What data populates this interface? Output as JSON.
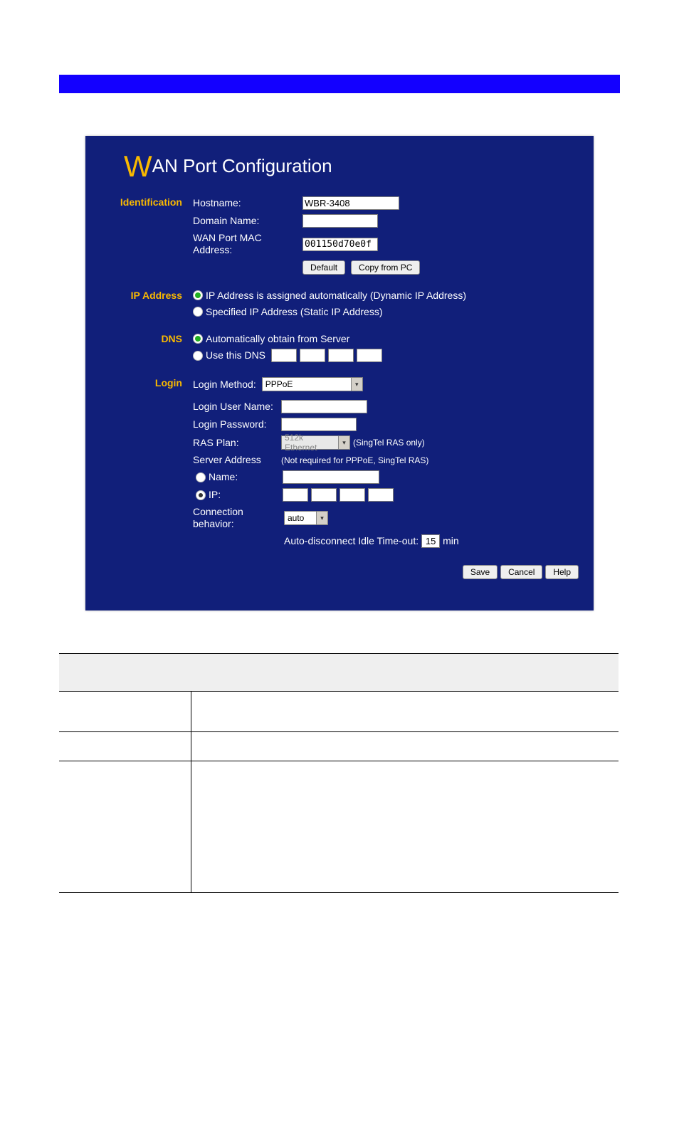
{
  "header": {
    "title_rest": "AN Port Configuration",
    "title_cap": "W"
  },
  "identification": {
    "label": "Identification",
    "hostname_label": "Hostname:",
    "hostname": "WBR-3408",
    "domain_label": "Domain Name:",
    "domain": "",
    "mac_label": "WAN Port MAC Address:",
    "mac": "001150d70e0f",
    "default_btn": "Default",
    "copy_btn": "Copy from PC"
  },
  "ip_address": {
    "label": "IP Address",
    "opt_dynamic": "IP Address is assigned automatically (Dynamic IP Address)",
    "opt_static": "Specified IP Address (Static IP Address)"
  },
  "dns": {
    "label": "DNS",
    "opt_auto": "Automatically obtain from Server",
    "opt_use": "Use this DNS"
  },
  "login": {
    "label": "Login",
    "method_label": "Login Method:",
    "method_value": "PPPoE",
    "user_label": "Login User Name:",
    "pass_label": "Login Password:",
    "ras_label": "RAS Plan:",
    "ras_value": "512k Ethernet",
    "ras_note": "(SingTel RAS only)",
    "server_addr_label": "Server Address",
    "server_addr_note": "(Not required for PPPoE, SingTel RAS)",
    "name_label": "Name:",
    "ip_label": "IP:",
    "conn_label": "Connection behavior:",
    "conn_value": "auto",
    "idle_label": "Auto-disconnect Idle Time-out:",
    "idle_value": "15",
    "idle_unit": "min"
  },
  "footer": {
    "save": "Save",
    "cancel": "Cancel",
    "help": "Help"
  }
}
